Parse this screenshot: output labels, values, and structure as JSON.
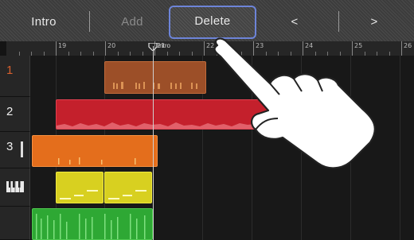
{
  "toolbar": {
    "intro_label": "Intro",
    "add_label": "Add",
    "delete_label": "Delete",
    "prev_label": "<",
    "next_label": ">"
  },
  "ruler": {
    "bars": [
      "19",
      "20",
      "21",
      "22",
      "23",
      "24",
      "25",
      "26"
    ],
    "marker_label": "Intro"
  },
  "tracks": [
    {
      "label": "1",
      "selected": true,
      "color": "#b0552a"
    },
    {
      "label": "2",
      "selected": false,
      "color": "#cc2230"
    },
    {
      "label": "3",
      "selected": false,
      "color": "#e07020"
    },
    {
      "label": "",
      "icon": "piano-keys-icon",
      "selected": false,
      "color": "#d8d020"
    },
    {
      "label": "",
      "selected": false,
      "color": "#2ea834"
    }
  ],
  "colors": {
    "highlight_border": "#6d84d8",
    "playhead": "#cfcfcf"
  }
}
